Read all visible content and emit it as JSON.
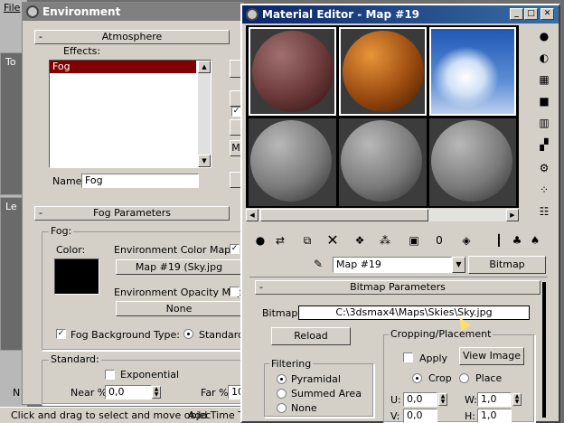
{
  "app": {
    "menu_file": "File",
    "viewport_top": "To",
    "viewport_left": "Le",
    "status_text": "Click and drag to select and move objec",
    "add_time": "Add Time T",
    "bottom_n": "N"
  },
  "environment": {
    "title": "Environment",
    "atmosphere_header": "Atmosphere",
    "effects_label": "Effects:",
    "effects_items": [
      "Fog"
    ],
    "name_label": "Name:",
    "name_value": "Fog",
    "side_m": "M",
    "fog_params_header": "Fog Parameters",
    "fog_group": "Fog:",
    "color_label": "Color:",
    "color_value": "#000000",
    "env_color_map_label": "Environment Color Map:",
    "env_color_map_button": "Map #19 (Sky.jpg",
    "env_opacity_map_label": "Environment Opacity Map:",
    "env_opacity_map_button": "None",
    "fog_background_label": "Fog Background",
    "type_label": "Type:",
    "type_standard": "Standard",
    "standard_group": "Standard:",
    "exponential_label": "Exponential",
    "near_label": "Near %:",
    "near_value": "0,0",
    "far_label": "Far %:",
    "far_value": "10"
  },
  "material_editor": {
    "title": "Material Editor - Map #19",
    "map_name": "Map #19",
    "map_type_button": "Bitmap",
    "bitmap_params_header": "Bitmap Parameters",
    "bitmap_label": "Bitmap:",
    "bitmap_path": "C:\\3dsmax4\\Maps\\Skies\\Sky.jpg",
    "reload_button": "Reload",
    "cropping_group": "Cropping/Placement",
    "apply_label": "Apply",
    "view_image_button": "View Image",
    "crop_label": "Crop",
    "place_label": "Place",
    "filtering_group": "Filtering",
    "filter_options": [
      "Pyramidal",
      "Summed Area",
      "None"
    ],
    "u_label": "U:",
    "u_value": "0,0",
    "w_label": "W:",
    "w_value": "1,0",
    "v_label": "V:",
    "v_value": "0,0",
    "h_label": "H:",
    "h_value": "1,0"
  },
  "colors": {
    "title_active": "#0a246a",
    "title_inactive": "#808080",
    "panel": "#d4d0c8",
    "selection": "#800000"
  }
}
